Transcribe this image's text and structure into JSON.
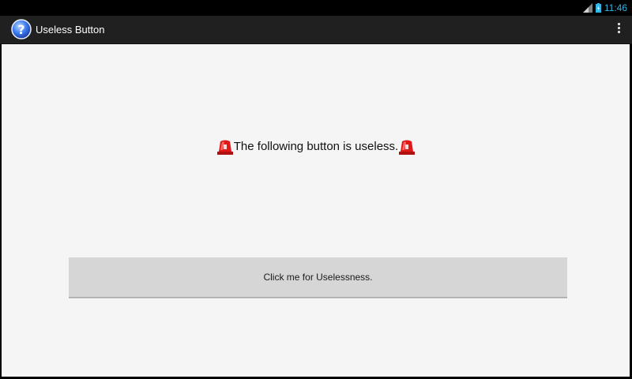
{
  "status_bar": {
    "time": "11:46",
    "icons": [
      "signal-icon",
      "battery-icon"
    ]
  },
  "action_bar": {
    "title": "Useless Button",
    "app_icon": "question-icon",
    "menu_icon": "overflow-menu-icon"
  },
  "main": {
    "message": "The following button is useless.",
    "message_icon": "alarm-light-icon",
    "button_label": "Click me for Uselessness."
  },
  "colors": {
    "clock": "#33b5e5",
    "action_bar": "#202020",
    "content_bg": "#f5f5f5",
    "button_bg": "#d6d6d6"
  }
}
